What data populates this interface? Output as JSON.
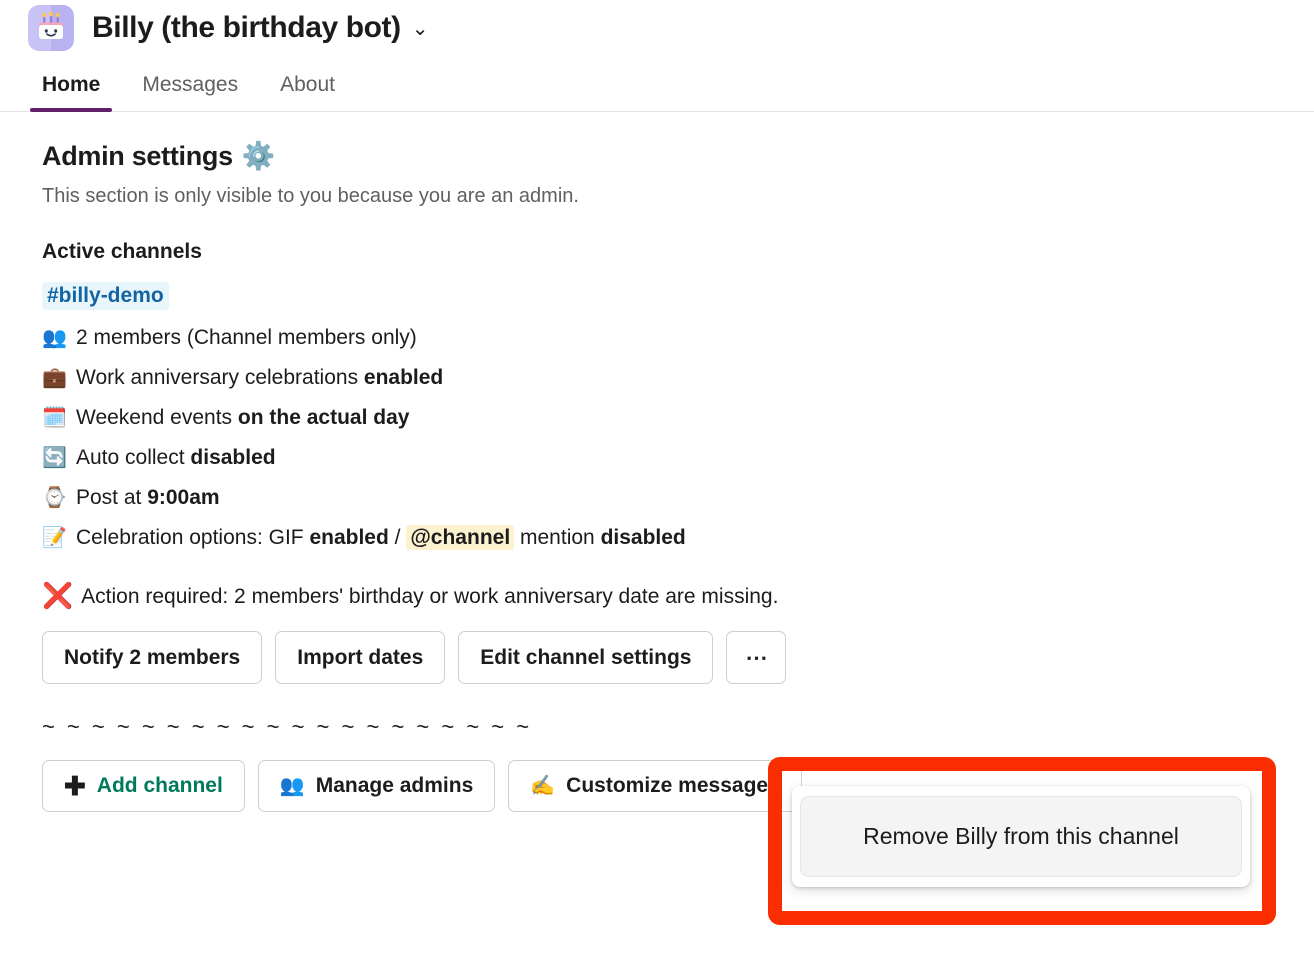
{
  "header": {
    "app_name": "Billy (the birthday bot)",
    "chevron": "⌄",
    "icon_name": "birthday-cake-icon"
  },
  "tabs": [
    {
      "label": "Home",
      "active": true
    },
    {
      "label": "Messages",
      "active": false
    },
    {
      "label": "About",
      "active": false
    }
  ],
  "admin": {
    "title": "Admin settings",
    "title_emoji": "⚙️",
    "note": "This section is only visible to you because you are an admin.",
    "subsection_title": "Active channels"
  },
  "channel": {
    "name": "#billy-demo",
    "details": [
      {
        "emoji": "👥",
        "emoji_name": "members-icon",
        "parts": [
          {
            "text": "2 members (Channel members only)",
            "bold": false
          }
        ]
      },
      {
        "emoji": "💼",
        "emoji_name": "briefcase-icon",
        "parts": [
          {
            "text": "Work anniversary celebrations ",
            "bold": false
          },
          {
            "text": "enabled",
            "bold": true
          }
        ]
      },
      {
        "emoji": "🗓️",
        "emoji_name": "calendar-icon",
        "parts": [
          {
            "text": "Weekend events ",
            "bold": false
          },
          {
            "text": "on the actual day",
            "bold": true
          }
        ]
      },
      {
        "emoji": "🔄",
        "emoji_name": "auto-collect-refresh-icon",
        "parts": [
          {
            "text": "Auto collect ",
            "bold": false
          },
          {
            "text": "disabled",
            "bold": true
          }
        ]
      },
      {
        "emoji": "⌚",
        "emoji_name": "watch-icon",
        "parts": [
          {
            "text": "Post at ",
            "bold": false
          },
          {
            "text": "9:00am",
            "bold": true
          }
        ]
      },
      {
        "emoji": "📝",
        "emoji_name": "memo-icon",
        "parts": [
          {
            "text": "Celebration options: GIF ",
            "bold": false
          },
          {
            "text": "enabled",
            "bold": true
          },
          {
            "text": " / ",
            "bold": false
          },
          {
            "text": "@channel",
            "bold": true,
            "mention": true
          },
          {
            "text": " mention ",
            "bold": false
          },
          {
            "text": "disabled",
            "bold": true
          }
        ]
      }
    ]
  },
  "action_required": {
    "emoji": "❌",
    "emoji_name": "cross-mark-icon",
    "text": "Action required: 2 members' birthday or work anniversary date are missing."
  },
  "channel_actions": [
    {
      "label": "Notify 2 members",
      "name": "notify-members-button"
    },
    {
      "label": "Import dates",
      "name": "import-dates-button"
    },
    {
      "label": "Edit channel settings",
      "name": "edit-channel-settings-button"
    },
    {
      "label": "⋯",
      "name": "more-options-button"
    }
  ],
  "divider": "~ ~ ~ ~ ~ ~ ~ ~ ~ ~ ~ ~ ~ ~ ~ ~ ~ ~ ~ ~",
  "global_actions": [
    {
      "label": "Add channel",
      "emoji": "➕",
      "emoji_name": "plus-icon",
      "green": true,
      "name": "add-channel-button"
    },
    {
      "label": "Manage admins",
      "emoji": "👥",
      "emoji_name": "members-icon",
      "green": false,
      "name": "manage-admins-button"
    },
    {
      "label": "Customize messages",
      "emoji": "✍️",
      "emoji_name": "writing-hand-icon",
      "green": false,
      "name": "customize-messages-button"
    }
  ],
  "popover": {
    "item_label": "Remove Billy from this channel"
  },
  "colors": {
    "accent_purple": "#611f69",
    "link_blue": "#1264a3",
    "link_blue_bg": "#e8f5fa",
    "mention_bg": "#fdf2d0",
    "green": "#007a5a",
    "highlight_red": "#fa2d00",
    "text": "#1d1c1d",
    "muted": "#616061"
  }
}
